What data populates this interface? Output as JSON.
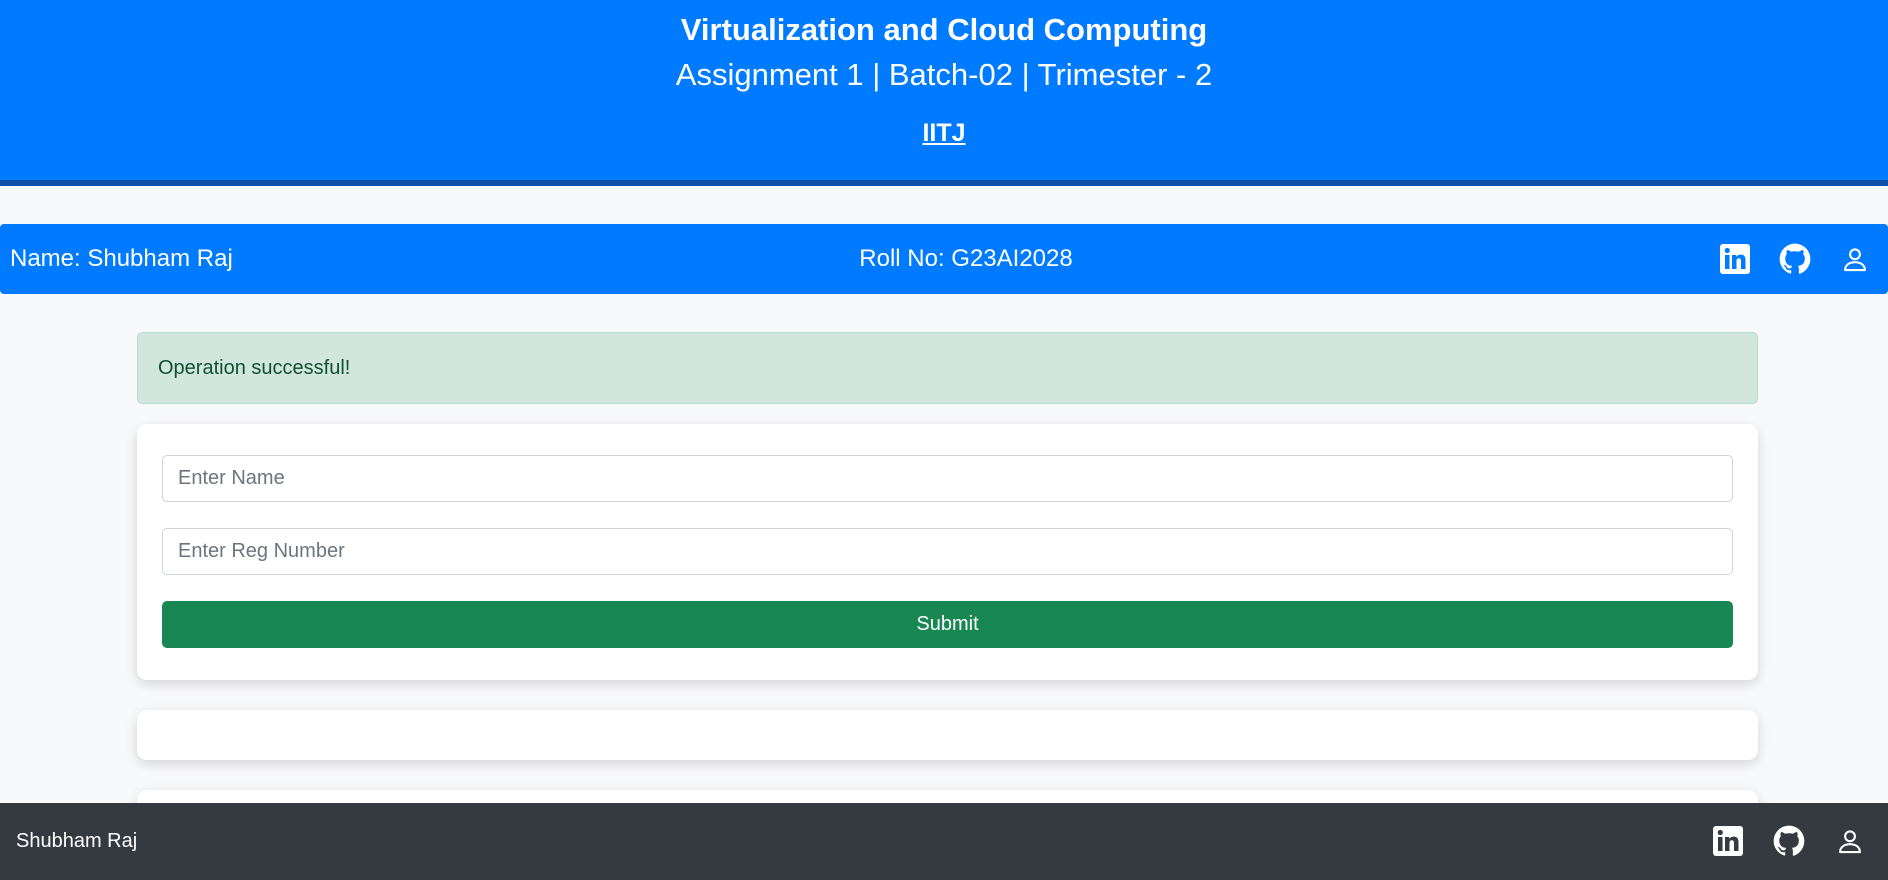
{
  "header": {
    "title": "Virtualization and Cloud Computing",
    "subtitle": "Assignment 1 | Batch-02 | Trimester - 2",
    "link": "IITJ"
  },
  "info_bar": {
    "name": "Name: Shubham Raj",
    "roll": "Roll No: G23AI2028",
    "icons": [
      "linkedin-icon",
      "github-icon",
      "user-icon"
    ]
  },
  "alert": {
    "message": "Operation successful!"
  },
  "form": {
    "name_placeholder": "Enter Name",
    "reg_placeholder": "Enter Reg Number",
    "submit_label": "Submit"
  },
  "footer": {
    "name": "Shubham Raj",
    "icons": [
      "linkedin-icon",
      "github-icon",
      "user-icon"
    ]
  },
  "colors": {
    "primary": "#007bff",
    "success": "#198754",
    "alert_bg": "#d1e7dd",
    "footer_bg": "#343a40"
  }
}
